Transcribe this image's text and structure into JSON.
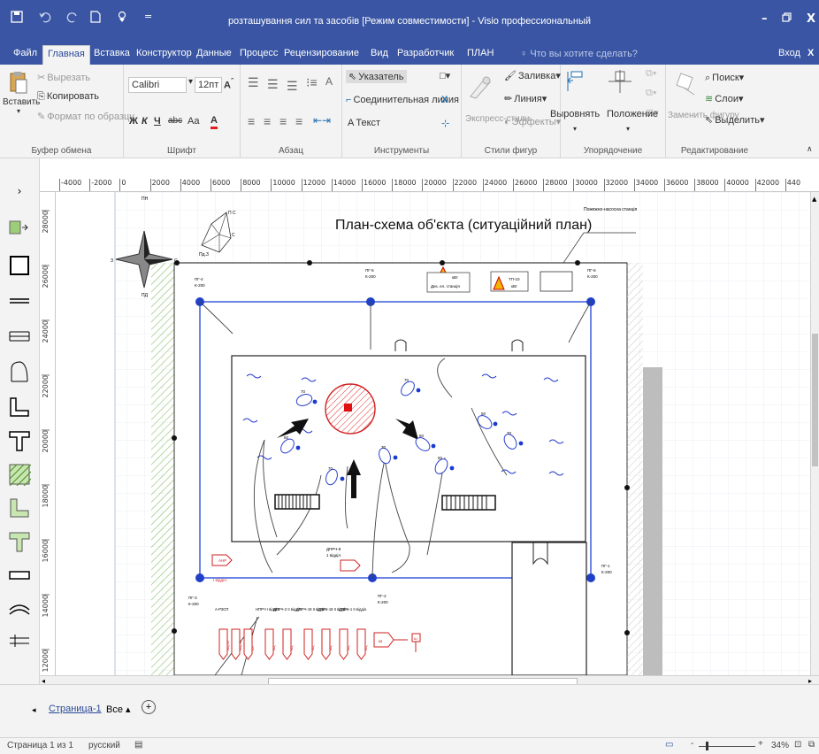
{
  "window": {
    "title": "розташування сил та засобів [Режим совместимости] - Visio профессиональный",
    "minimize_glyph": "–",
    "restore_glyph": "🗗",
    "close_glyph": "X"
  },
  "qat": {
    "save_icon": "save-icon",
    "undo_icon": "undo-icon",
    "redo_icon": "redo-icon",
    "new_icon": "new-file-icon",
    "touch_icon": "touch-mode-icon",
    "more_icon": "customize-qat-icon"
  },
  "menu": {
    "tabs": [
      "Файл",
      "Главная",
      "Вставка",
      "Конструктор",
      "Данные",
      "Процесс",
      "Рецензирование",
      "Вид",
      "Разработчик",
      "ПЛАН"
    ],
    "active_tab": "Главная",
    "tell_me": "Что вы хотите сделать?",
    "signin": "Вход",
    "share_glyph": "X"
  },
  "ribbon": {
    "clipboard": {
      "label": "Буфер обмена",
      "paste": "Вставить",
      "cut": "Вырезать",
      "copy": "Копировать",
      "format_painter": "Формат по образцу"
    },
    "font": {
      "label": "Шрифт",
      "font_name": "Calibri",
      "font_size": "12пт",
      "bold": "Ж",
      "italic": "К",
      "underline": "Ч",
      "strike": "abc",
      "case": "Aa",
      "color": "А"
    },
    "paragraph": {
      "label": "Абзац"
    },
    "tools": {
      "label": "Инструменты",
      "pointer": "Указатель",
      "connector": "Соединительная линия",
      "text": "Текст"
    },
    "shape_styles": {
      "label": "Стили фигур",
      "fill": "Заливка",
      "line": "Линия",
      "effects": "Эффекты",
      "quick_styles": "Экспресс-стили"
    },
    "arrange": {
      "label": "Упорядочение",
      "align": "Выровнять",
      "position": "Положение"
    },
    "editing": {
      "label": "Редактирование",
      "find": "Поиск",
      "layers": "Слои",
      "select": "Выделить",
      "change_shape": "Заменить фигуру"
    }
  },
  "ruler": {
    "top_ticks": [
      "-4000",
      "-2000",
      "0",
      "2000",
      "4000",
      "6000",
      "8000",
      "10000",
      "12000",
      "14000",
      "16000",
      "18000",
      "20000",
      "22000",
      "24000",
      "26000",
      "28000",
      "30000",
      "32000",
      "34000",
      "36000",
      "38000",
      "40000",
      "42000",
      "440"
    ],
    "left_ticks": [
      "28000",
      "26000",
      "24000",
      "22000",
      "20000",
      "18000",
      "16000",
      "14000",
      "12000"
    ]
  },
  "drawing": {
    "title": "План-схема об'єкта (ситуаційний план)",
    "pump_station_label": "Пожежно-насосна станція",
    "compass": {
      "north": "ПН",
      "south": "ПД",
      "east": "С",
      "west": "З"
    },
    "wind_rose_label": "Пд.З",
    "wind_rose_n": "П С",
    "wind_rose_e": "С",
    "hydrants": [
      {
        "id": "ПГ-4",
        "sub": "К-200"
      },
      {
        "id": "ПГ-5",
        "sub": "К-200"
      },
      {
        "id": "ПГ-6",
        "sub": "К-200"
      },
      {
        "id": "ПГ-1",
        "sub": "К-200"
      },
      {
        "id": "ПГ-2",
        "sub": "К-200"
      },
      {
        "id": "ПГ-3",
        "sub": "К-200"
      }
    ],
    "diesel_label": "Диз. ел. станція",
    "diesel_power": "кВт",
    "substation_label": "ТП-10",
    "substation_power": "кВт",
    "nozzle_labels": [
      "70",
      "70",
      "50",
      "50",
      "70",
      "70",
      "50",
      "50",
      "70"
    ],
    "vehicle_label_1": "АНР",
    "vehicle_label_1_sub": "I відділ.",
    "vehicle_label_2": "ДПРЧ-8",
    "vehicle_label_2_sub": "1 відділ.",
    "units": [
      "А-РЗСП",
      "НПРЧ I відділ.",
      "ДПРЧ-2 II відділ.",
      "ДПРЧ-19 II відділ.",
      "ДПРЧ-18 II відділ.",
      "ДПРЧ-1 II відділ."
    ],
    "truck_labels": [
      "АЦ-40",
      "АЦ-40",
      "АЛ",
      "АЦ",
      "АЦ",
      "АЦ",
      "АЦ",
      "АЦ",
      "АЦ"
    ],
    "legend_mark": "Ш",
    "legend_mark_2": "Ш"
  },
  "pages": {
    "active": "Страница-1",
    "all": "Все",
    "add_glyph": "+"
  },
  "status": {
    "page": "Страница 1 из 1",
    "language": "русский",
    "zoom": "34%"
  },
  "colors": {
    "titlebar": "#3955a3",
    "hydrant_line": "#3050d8",
    "hatch_red": "#e03030",
    "accent_blue": "#2b4a97"
  }
}
